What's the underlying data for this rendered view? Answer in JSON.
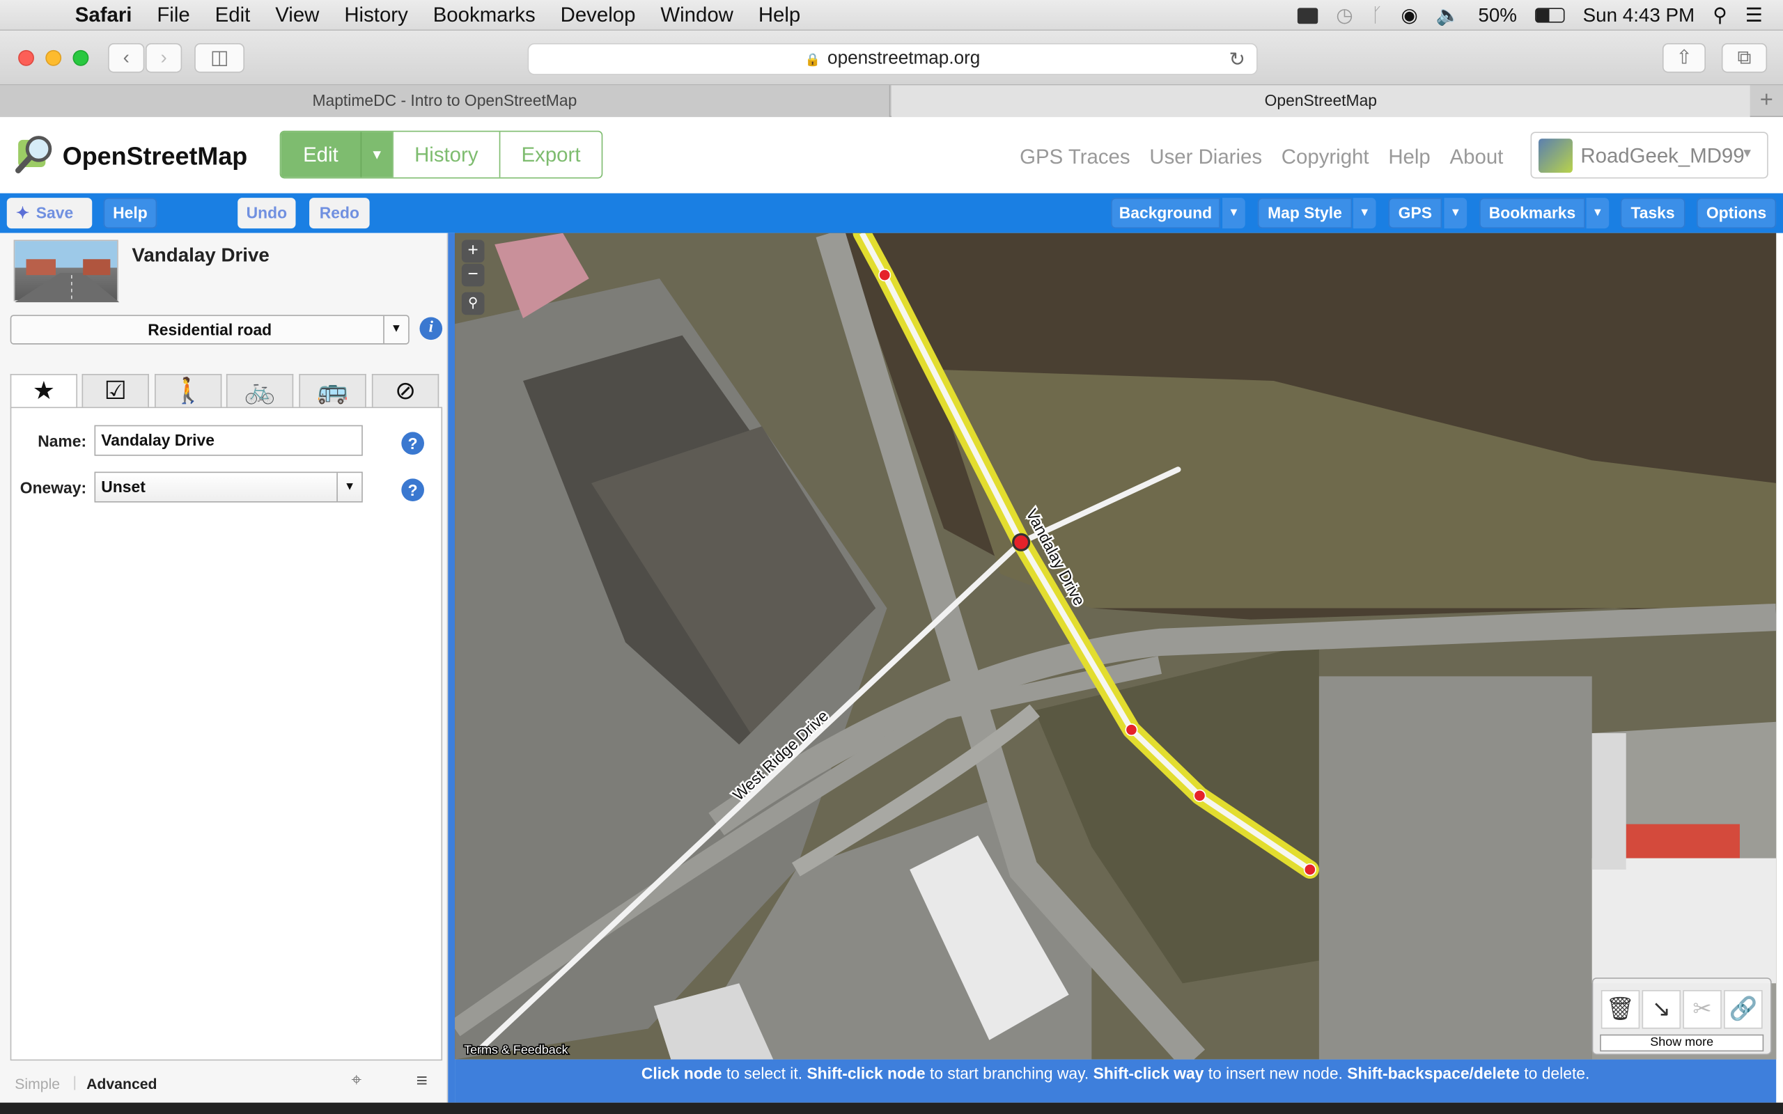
{
  "menubar": {
    "app": "Safari",
    "items": [
      "File",
      "Edit",
      "View",
      "History",
      "Bookmarks",
      "Develop",
      "Window",
      "Help"
    ],
    "battery": "50%",
    "clock": "Sun 4:43 PM"
  },
  "browser": {
    "url": "openstreetmap.org",
    "tabs": [
      "MaptimeDC - Intro to OpenStreetMap",
      "OpenStreetMap"
    ]
  },
  "osm": {
    "brand": "OpenStreetMap",
    "edit": "Edit",
    "history": "History",
    "export": "Export",
    "nav": [
      "GPS Traces",
      "User Diaries",
      "Copyright",
      "Help",
      "About"
    ],
    "user": "RoadGeek_MD99"
  },
  "idbar": {
    "save": "Save",
    "help": "Help",
    "undo": "Undo",
    "redo": "Redo",
    "background": "Background",
    "mapstyle": "Map Style",
    "gps": "GPS",
    "bookmarks": "Bookmarks",
    "tasks": "Tasks",
    "options": "Options"
  },
  "feature": {
    "name": "Vandalay Drive",
    "preset": "Residential road",
    "fields": {
      "name_label": "Name:",
      "name_value": "Vandalay Drive",
      "oneway_label": "Oneway:",
      "oneway_value": "Unset"
    }
  },
  "sidebar_footer": {
    "simple": "Simple",
    "advanced": "Advanced"
  },
  "map": {
    "labels": {
      "vandalay": "Vandalay Drive",
      "westridge": "West Ridge Drive"
    },
    "attribution": "Terms & Feedback",
    "show_more": "Show more"
  },
  "status": {
    "p1b": "Click node",
    "p1": " to select it. ",
    "p2b": "Shift-click node",
    "p2": " to start branching way. ",
    "p3b": "Shift-click way",
    "p3": " to insert new node. ",
    "p4b": "Shift-backspace/delete",
    "p4": " to delete."
  }
}
